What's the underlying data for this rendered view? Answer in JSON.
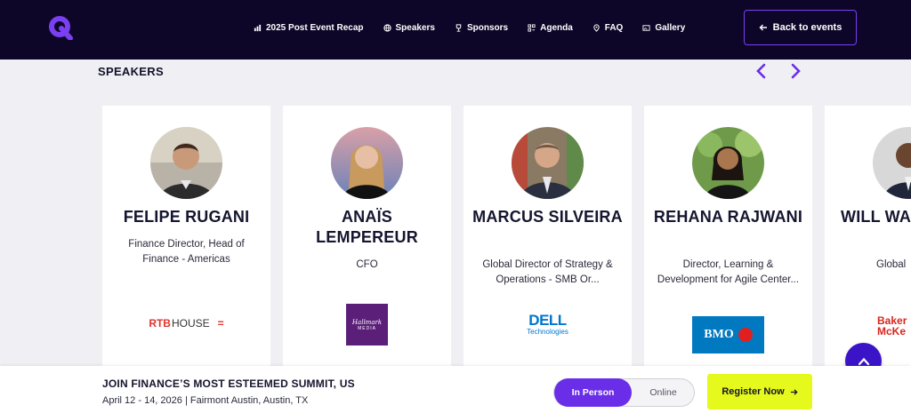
{
  "nav": {
    "items": [
      {
        "label": "2025 Post Event Recap",
        "icon": "bar-chart-icon"
      },
      {
        "label": "Speakers",
        "icon": "globe-icon"
      },
      {
        "label": "Sponsors",
        "icon": "trophy-icon"
      },
      {
        "label": "Agenda",
        "icon": "agenda-icon"
      },
      {
        "label": "FAQ",
        "icon": "location-pin-icon"
      },
      {
        "label": "Gallery",
        "icon": "image-icon"
      }
    ],
    "back_label": "Back to events"
  },
  "section": {
    "title": "SPEAKERS"
  },
  "speakers": [
    {
      "name": "FELIPE RUGANI",
      "role": "Finance Director, Head of Finance - Americas",
      "company": "RTB HOUSE"
    },
    {
      "name": "ANAÏS LEMPEREUR",
      "role": "CFO",
      "company": "Hallmark Media"
    },
    {
      "name": "MARCUS SILVEIRA",
      "role": "Global Director of Strategy & Operations - SMB Or...",
      "company": "DELL Technologies"
    },
    {
      "name": "REHANA RAJWANI",
      "role": "Director, Learning & Development for Agile Center...",
      "company": "BMO"
    },
    {
      "name": "WILL WASHING",
      "role": "Global",
      "company": "Baker McKe"
    }
  ],
  "logos": {
    "rtb_a": "RTB",
    "rtb_b": "HOUSE",
    "hallmark_a": "Hallmark",
    "hallmark_b": "MEDIA",
    "dell_a": "DELL",
    "dell_b": "Technologies",
    "bmo": "BMO",
    "baker_a": "Baker",
    "baker_b": "McKe"
  },
  "cta": {
    "title": "JOIN FINANCE’S MOST ESTEEMED SUMMIT, US",
    "subtitle": "April 12 - 14, 2026 | Fairmont Austin, Austin, TX",
    "toggle_on": "In Person",
    "toggle_off": "Online",
    "register_label": "Register Now"
  },
  "colors": {
    "nav_bg": "#0d0628",
    "accent": "#6a2de8",
    "register_bg": "#e6f91c",
    "page_bg": "#f0eff3"
  }
}
